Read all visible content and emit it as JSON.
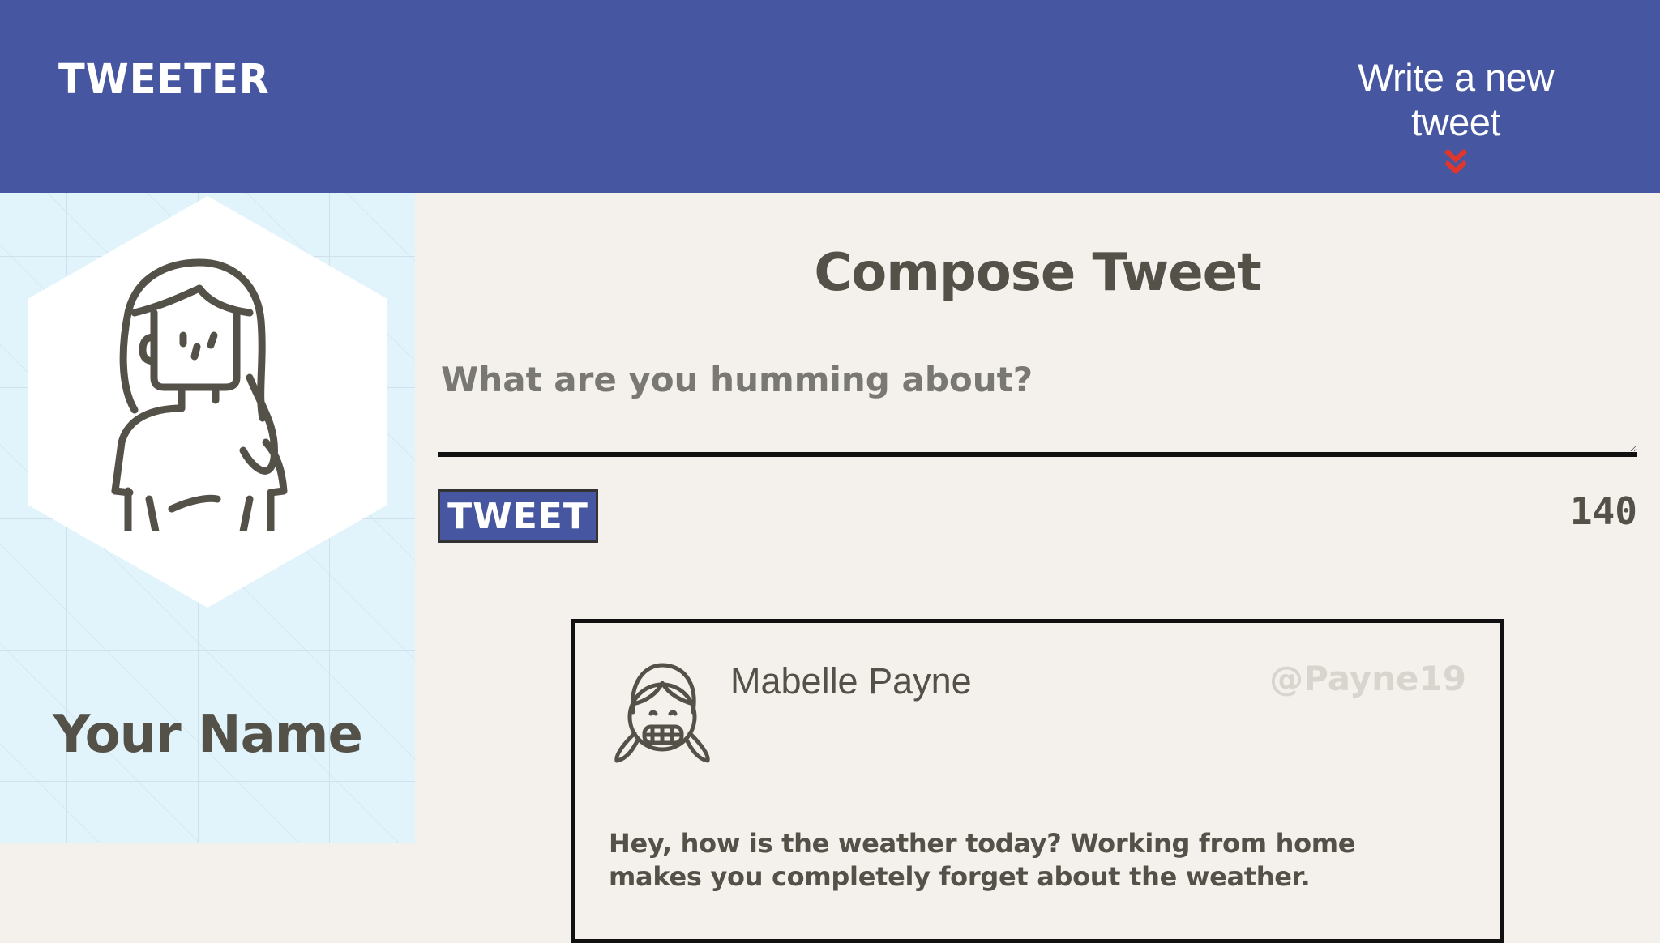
{
  "nav": {
    "brand": "TWEETER",
    "compose_toggle": "Write a new tweet",
    "compose_toggle_icon": "double-chevron-down-icon"
  },
  "profile": {
    "avatar_icon": "woman-avatar-icon",
    "name": "Your Name"
  },
  "compose": {
    "title": "Compose Tweet",
    "placeholder": "What are you humming about?",
    "value": "",
    "button_label": "TWEET",
    "counter": "140"
  },
  "tweets": [
    {
      "avatar_icon": "girl-avatar-icon",
      "name": "Mabelle Payne",
      "handle": "@Payne19",
      "text": "Hey, how is the weather today? Working from home makes you completely forget about the weather."
    }
  ],
  "colors": {
    "header_bg": "#4656a0",
    "page_bg": "#f4f1ec",
    "profile_bg": "#e2f4fb",
    "accent_red": "#e0362c",
    "text_dark": "#545149",
    "handle_gray": "#d8d5cf"
  }
}
